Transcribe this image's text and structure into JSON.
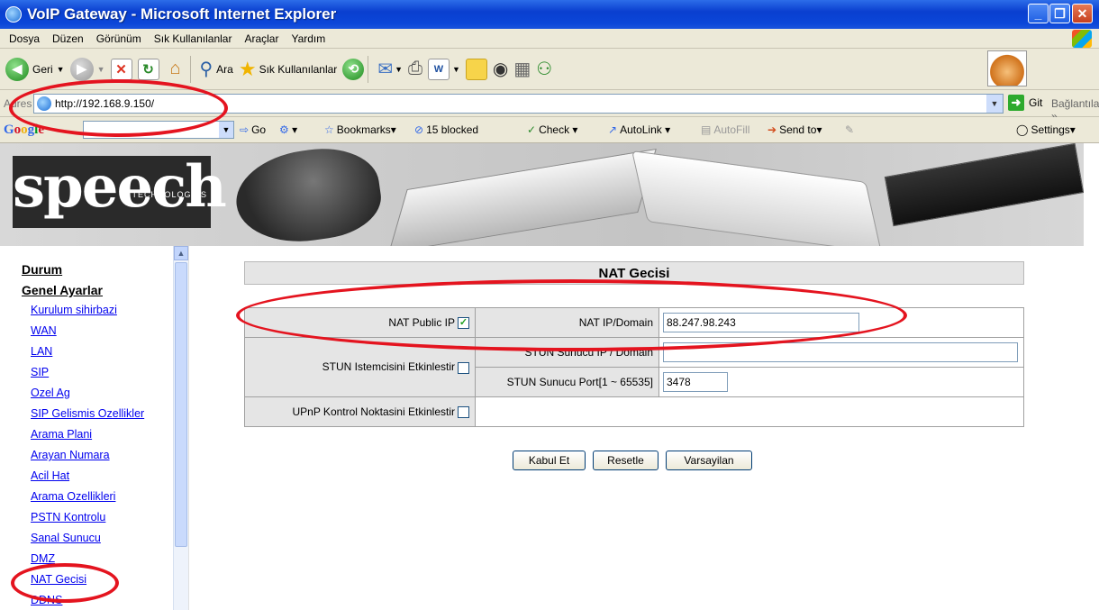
{
  "window": {
    "title": "VoIP Gateway - Microsoft Internet Explorer"
  },
  "menu": [
    "Dosya",
    "Düzen",
    "Görünüm",
    "Sık Kullanılanlar",
    "Araçlar",
    "Yardım"
  ],
  "toolbar": {
    "back_label": "Geri",
    "search_label": "Ara",
    "favorites_label": "Sık Kullanılanlar"
  },
  "address": {
    "label": "Adres",
    "url": "http://192.168.9.150/",
    "go_label": "Git",
    "links_label": "Bağlantılar"
  },
  "googlebar": {
    "logo": "Google",
    "go_label": "Go",
    "bookmarks_label": "Bookmarks",
    "blocked_label": "15 blocked",
    "check_label": "Check",
    "autolink_label": "AutoLink",
    "autofill_label": "AutoFill",
    "sendto_label": "Send to",
    "settings_label": "Settings"
  },
  "banner": {
    "logo_text": "speech",
    "logo_sub": "TECHNOLOGIES"
  },
  "sidebar": {
    "heading_status": "Durum",
    "heading_general": "Genel Ayarlar",
    "items": [
      "Kurulum sihirbazi",
      "WAN",
      "LAN",
      "SIP",
      "Ozel Ag",
      "SIP Gelismis Ozellikler",
      "Arama Plani",
      "Arayan Numara",
      "Acil Hat",
      "Arama Ozellikleri",
      "PSTN Kontrolu",
      "Sanal Sunucu",
      "DMZ",
      "NAT Gecisi",
      "DDNS"
    ]
  },
  "page": {
    "title": "NAT Gecisi",
    "nat_public_ip_label": "NAT Public IP",
    "nat_public_ip_checked": true,
    "nat_domain_label": "NAT IP/Domain",
    "nat_domain_value": "88.247.98.243",
    "stun_enable_label": "STUN Istemcisini Etkinlestir",
    "stun_server_label": "STUN Sunucu IP / Domain",
    "stun_server_value": "",
    "stun_port_label": "STUN Sunucu Port[1 ~ 65535]",
    "stun_port_value": "3478",
    "upnp_label": "UPnP Kontrol Noktasini Etkinlestir",
    "accept_button": "Kabul Et",
    "reset_button": "Resetle",
    "default_button": "Varsayilan"
  },
  "colors": {
    "annotation": "#e4141f",
    "link": "#0000ee",
    "titlebar": "#0a3fd0"
  }
}
